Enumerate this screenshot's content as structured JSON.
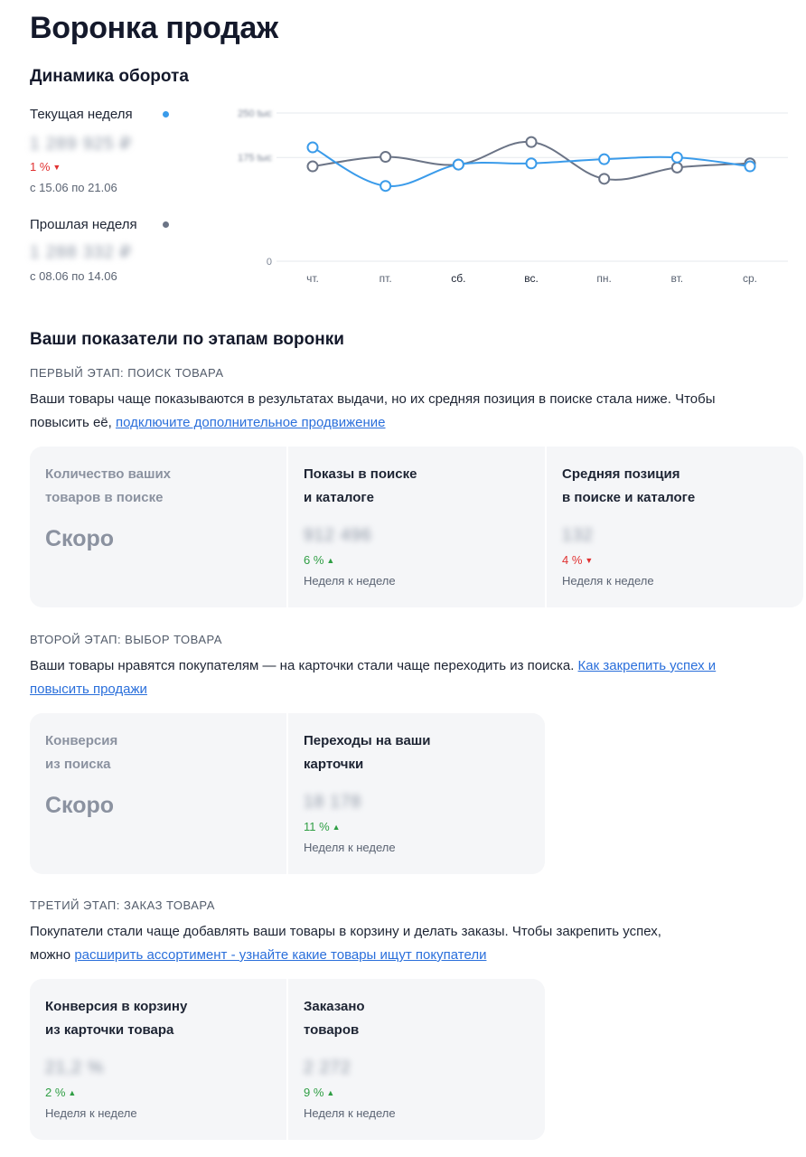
{
  "page": {
    "title": "Воронка продаж"
  },
  "dynamics": {
    "title": "Динамика оборота",
    "current": {
      "label": "Текущая неделя",
      "value": "1 289 925 ₽",
      "delta": "1 %",
      "delta_dir": "down",
      "period": "с 15.06 по 21.06",
      "color": "#3a9bea"
    },
    "previous": {
      "label": "Прошлая неделя",
      "value": "1 288 332 ₽",
      "period": "с 08.06 по 14.06",
      "color": "#6b7486"
    }
  },
  "chart_data": {
    "type": "line",
    "categories": [
      "чт.",
      "пт.",
      "сб.",
      "вс.",
      "пн.",
      "вт.",
      "ср."
    ],
    "y_ticks": [
      "250 tыс",
      "175 tыс",
      "0"
    ],
    "ylim": [
      0,
      250
    ],
    "series": [
      {
        "name": "Текущая неделя",
        "color": "#3a9bea",
        "values": [
          192,
          127,
          163,
          165,
          172,
          175,
          160
        ]
      },
      {
        "name": "Прошлая неделя",
        "color": "#6b7486",
        "values": [
          160,
          176,
          163,
          201,
          139,
          158,
          165
        ]
      }
    ],
    "grid": true
  },
  "funnel": {
    "title": "Ваши показатели по этапам воронки",
    "stage1": {
      "label": "ПЕРВЫЙ ЭТАП: ПОИСК ТОВАРА",
      "text1": "Ваши товары чаще показываются в результатах выдачи, но их средняя позиция в поиске стала ниже. Чтобы",
      "text2_prefix": "повысить её, ",
      "link": "подключите дополнительное продвижение",
      "cards": [
        {
          "title1": "Количество ваших",
          "title2": "товаров в поиске",
          "soon": "Скоро"
        },
        {
          "title1": "Показы в поиске",
          "title2": "и каталоге",
          "value": "912 496",
          "delta": "6 %",
          "dir": "up",
          "note": "Неделя к неделе"
        },
        {
          "title1": "Средняя позиция",
          "title2": "в поиске и каталоге",
          "value": "132",
          "delta": "4 %",
          "dir": "down",
          "note": "Неделя к неделе"
        }
      ]
    },
    "stage2": {
      "label": "ВТОРОЙ ЭТАП: ВЫБОР ТОВАРА",
      "text1": "Ваши товары нравятся покупателям — на карточки стали чаще переходить из поиска. ",
      "link1": "Как закрепить успех и",
      "link2": "повысить продажи",
      "cards": [
        {
          "title1": "Конверсия",
          "title2": "из поиска",
          "soon": "Скоро"
        },
        {
          "title1": "Переходы на ваши",
          "title2": "карточки",
          "value": "18 178",
          "delta": "11 %",
          "dir": "up",
          "note": "Неделя к неделе"
        }
      ]
    },
    "stage3": {
      "label": "ТРЕТИЙ ЭТАП: ЗАКАЗ ТОВАРА",
      "text1": "Покупатели стали чаще добавлять ваши товары в корзину и делать заказы. Чтобы закрепить успех,",
      "text2_prefix": "можно ",
      "link": "расширить ассортимент - узнайте какие товары ищут покупатели",
      "cards": [
        {
          "title1": "Конверсия в корзину",
          "title2": "из карточки товара",
          "value": "21,2 %",
          "delta": "2 %",
          "dir": "up",
          "note": "Неделя к неделе"
        },
        {
          "title1": "Заказано",
          "title2": "товаров",
          "value": "2 272",
          "delta": "9 %",
          "dir": "up",
          "note": "Неделя к неделе"
        }
      ]
    }
  }
}
